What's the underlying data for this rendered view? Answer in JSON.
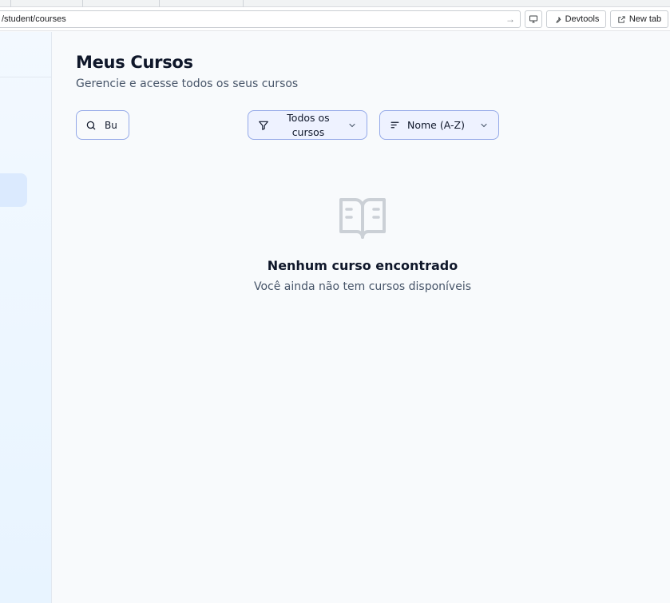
{
  "browser": {
    "url": "/student/courses",
    "devtools_label": "Devtools",
    "new_tab_label": "New tab"
  },
  "page": {
    "title": "Meus Cursos",
    "subtitle": "Gerencie e acesse todos os seus cursos"
  },
  "filters": {
    "search_value": "Bu",
    "category_label": "Todos os cursos",
    "sort_label": "Nome (A-Z)"
  },
  "empty_state": {
    "icon": "book-open-icon",
    "title": "Nenhum curso encontrado",
    "description": "Você ainda não tem cursos disponíveis"
  },
  "colors": {
    "accent_border": "#93a8e8",
    "background": "#f8fafc",
    "sidebar": "#e8f4ff"
  }
}
